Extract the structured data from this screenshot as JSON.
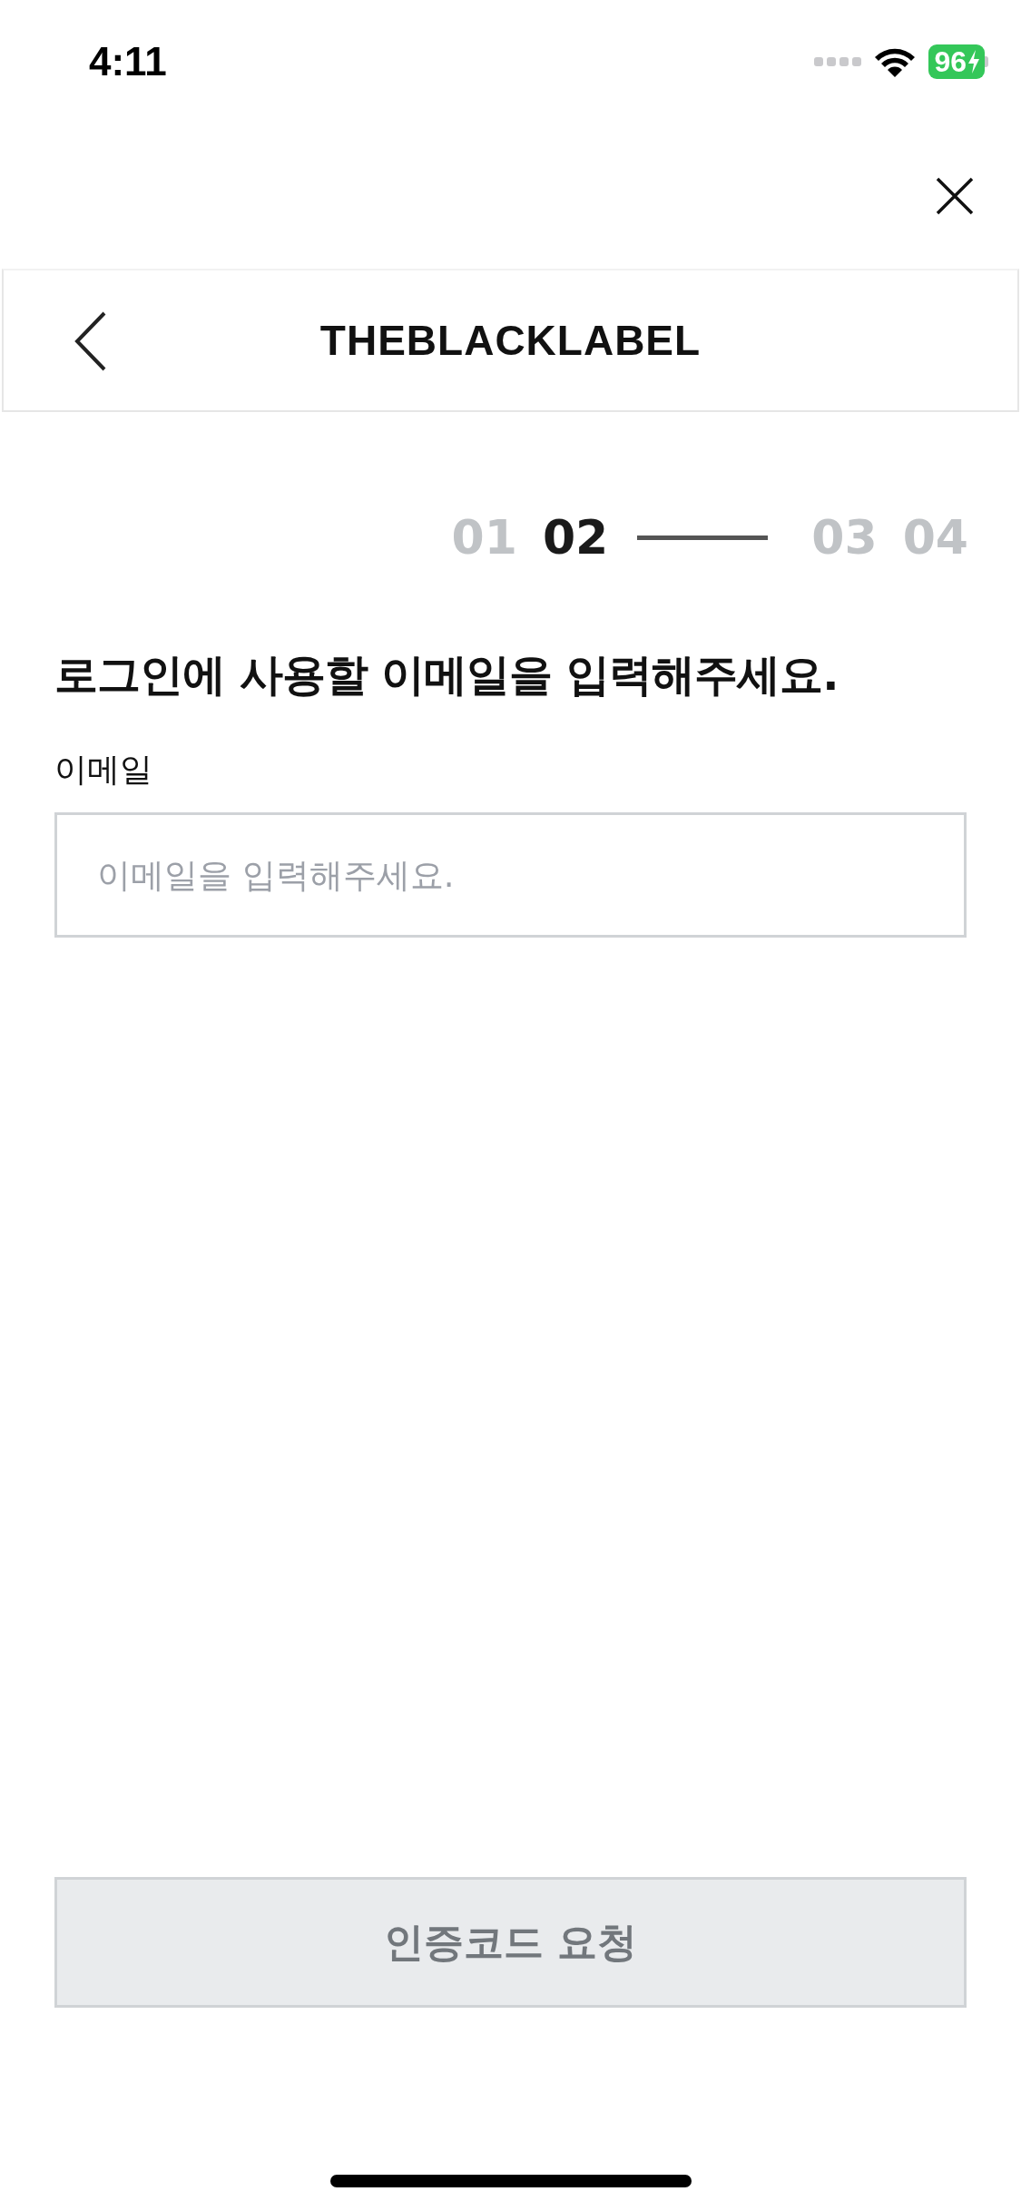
{
  "status_bar": {
    "time": "4:11",
    "battery": "96"
  },
  "header": {
    "logo": "THEBLACKLABEL"
  },
  "steps": [
    {
      "label": "01",
      "selected": false
    },
    {
      "label": "02",
      "selected": true
    },
    {
      "label": "03",
      "selected": false
    },
    {
      "label": "04",
      "selected": false
    }
  ],
  "title": "로그인에 사용할 이메일을 입력해주세요.",
  "email_field": {
    "label": "이메일",
    "placeholder": "이메일을 입력해주세요."
  },
  "submit_button": {
    "label": "인증코드 요청",
    "disabled": true
  }
}
